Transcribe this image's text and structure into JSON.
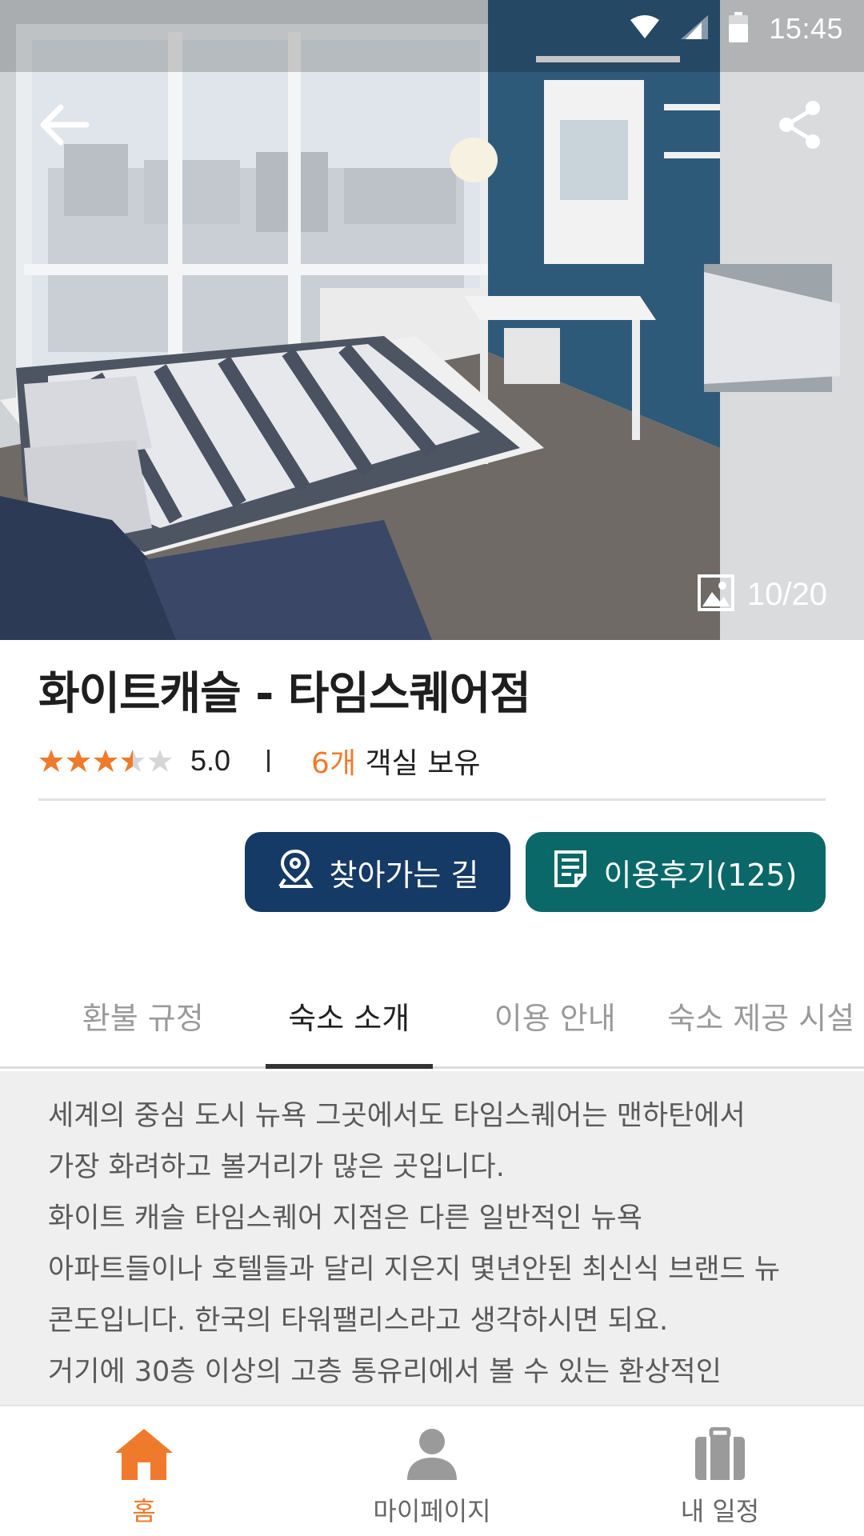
{
  "status_bar": {
    "time": "15:45",
    "icons": [
      "wifi-icon",
      "signal-icon",
      "battery-icon"
    ]
  },
  "hero": {
    "photo_counter": "10/20",
    "icons": {
      "back": "arrow-left-icon",
      "share": "share-icon",
      "photo": "image-icon"
    }
  },
  "venue": {
    "title": "화이트캐슬 - 타임스퀘어점",
    "rating": {
      "value": "5.0",
      "stars_filled": 3.5,
      "stars_total": 5
    },
    "rooms": {
      "count": "6개",
      "suffix": " 객실 보유"
    }
  },
  "actions": {
    "directions": {
      "label": "찾아가는 길",
      "icon": "map-pin-icon"
    },
    "reviews": {
      "label": "이용후기(125)",
      "icon": "document-icon"
    }
  },
  "tabs": [
    {
      "label": "환불 규정",
      "active": false
    },
    {
      "label": "숙소 소개",
      "active": true
    },
    {
      "label": "이용 안내",
      "active": false
    },
    {
      "label": "숙소 제공 시설",
      "active": false
    }
  ],
  "description": [
    "세계의 중심 도시 뉴욕 그곳에서도 타임스퀘어는 맨하탄에서",
    "가장 화려하고 볼거리가 많은 곳입니다.",
    "화이트 캐슬 타임스퀘어  지점은 다른 일반적인 뉴욕",
    "아파트들이나 호텔들과 달리 지은지 몇년안된 최신식 브랜드 뉴",
    "콘도입니다. 한국의 타워팰리스라고 생각하시면 되요.",
    "거기에 30층 이상의 고층 통유리에서 볼 수 있는  환상적인"
  ],
  "bottom_nav": [
    {
      "label": "홈",
      "icon": "home-icon",
      "active": true
    },
    {
      "label": "마이페이지",
      "icon": "user-icon",
      "active": false
    },
    {
      "label": "내 일정",
      "icon": "suitcase-icon",
      "active": false
    }
  ],
  "colors": {
    "accent": "#f07a2b",
    "directions_button": "#153a66",
    "reviews_button": "#0b6868",
    "description_bg": "#efefef"
  }
}
